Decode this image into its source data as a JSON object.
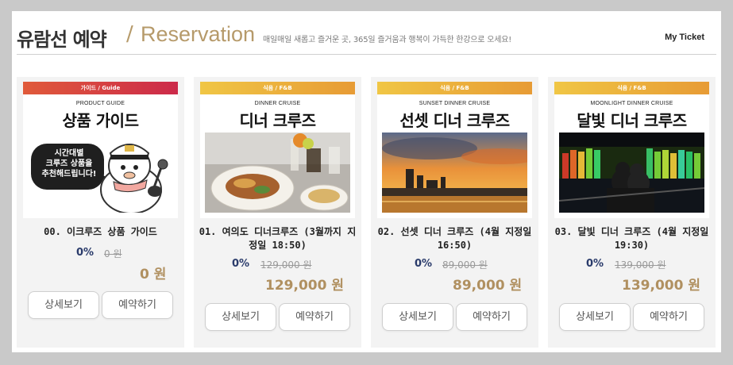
{
  "header": {
    "title_ko": "유람선 예약",
    "separator": "/",
    "title_en": "Reservation",
    "subtitle": "매일매일 새롭고 즐거운 곳, 365일 즐거움과 행복이 가득한 한강으로 오세요!",
    "my_ticket": "My Ticket"
  },
  "cards": [
    {
      "category": "가이드 / Guide",
      "thumb_sub": "PRODUCT GUIDE",
      "thumb_title": "상품 가이드",
      "bubble_line1": "시간대별",
      "bubble_line2": "크루즈 상품을",
      "bubble_line3": "추천해드립니다!",
      "name": "00. 이크루즈 상품 가이드",
      "discount": "0%",
      "original_price": "0 원",
      "final_price": "0 원",
      "detail_btn": "상세보기",
      "reserve_btn": "예약하기"
    },
    {
      "category": "식음 / F&B",
      "thumb_sub": "DINNER CRUISE",
      "thumb_title": "디너 크루즈",
      "name": "01. 여의도 디너크루즈 (3월까지 지정일 18:50)",
      "discount": "0%",
      "original_price": "129,000 원",
      "final_price": "129,000 원",
      "detail_btn": "상세보기",
      "reserve_btn": "예약하기"
    },
    {
      "category": "식음 / F&B",
      "thumb_sub": "SUNSET DINNER CRUISE",
      "thumb_title": "선셋 디너 크루즈",
      "name": "02. 선셋 디너 크루즈 (4월 지정일 16:50)",
      "discount": "0%",
      "original_price": "89,000 원",
      "final_price": "89,000 원",
      "detail_btn": "상세보기",
      "reserve_btn": "예약하기"
    },
    {
      "category": "식음 / F&B",
      "thumb_sub": "MOONLIGHT DINNER CRUISE",
      "thumb_title": "달빛 디너 크루즈",
      "name": "03. 달빛 디너 크루즈 (4월 지정일 19:30)",
      "discount": "0%",
      "original_price": "139,000 원",
      "final_price": "139,000 원",
      "detail_btn": "상세보기",
      "reserve_btn": "예약하기"
    }
  ],
  "colors": {
    "accent_gold": "#b09060",
    "discount_navy": "#2a3b6b",
    "guide_bar": "#d6404a",
    "fb_bar": "#eab23c"
  }
}
